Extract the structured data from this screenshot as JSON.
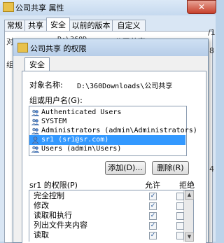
{
  "bg": {
    "title": "公司共享 属性",
    "tabs": [
      "常规",
      "共享",
      "安全",
      "以前的版本",
      "自定义"
    ],
    "peek_object": "对",
    "peek_path": "D:\\360D",
    "peek_right": "\\公司共享",
    "peek_group": "组",
    "peek_digits": "/1",
    "peek_8": "8",
    "peek_tail": "4",
    "close_glyph": "✕"
  },
  "dialog": {
    "title": "公司共享 的权限",
    "tab": "安全",
    "object_label": "对象名称:",
    "object_value": "D:\\360Downloads\\公司共享",
    "group_label": "组或用户名(G):",
    "users": [
      {
        "name": "Authenticated Users",
        "icon": "users-icon",
        "selected": false
      },
      {
        "name": "SYSTEM",
        "icon": "users-icon",
        "selected": false
      },
      {
        "name": "Administrators (admin\\Administrators)",
        "icon": "users-icon",
        "selected": false
      },
      {
        "name": "sr1 (sr1@sr.com)",
        "icon": "user-icon",
        "selected": true
      },
      {
        "name": "Users (admin\\Users)",
        "icon": "users-icon",
        "selected": false
      }
    ],
    "add_button": "添加(D)...",
    "remove_button": "删除(R)",
    "perm_for": "sr1 的权限(P)",
    "allow_header": "允许",
    "deny_header": "拒绝",
    "permissions": [
      {
        "name": "完全控制",
        "allow": true,
        "deny": false
      },
      {
        "name": "修改",
        "allow": true,
        "deny": false
      },
      {
        "name": "读取和执行",
        "allow": true,
        "deny": false
      },
      {
        "name": "列出文件夹内容",
        "allow": true,
        "deny": false
      },
      {
        "name": "读取",
        "allow": true,
        "deny": false
      }
    ],
    "check_glyph": "✓"
  }
}
